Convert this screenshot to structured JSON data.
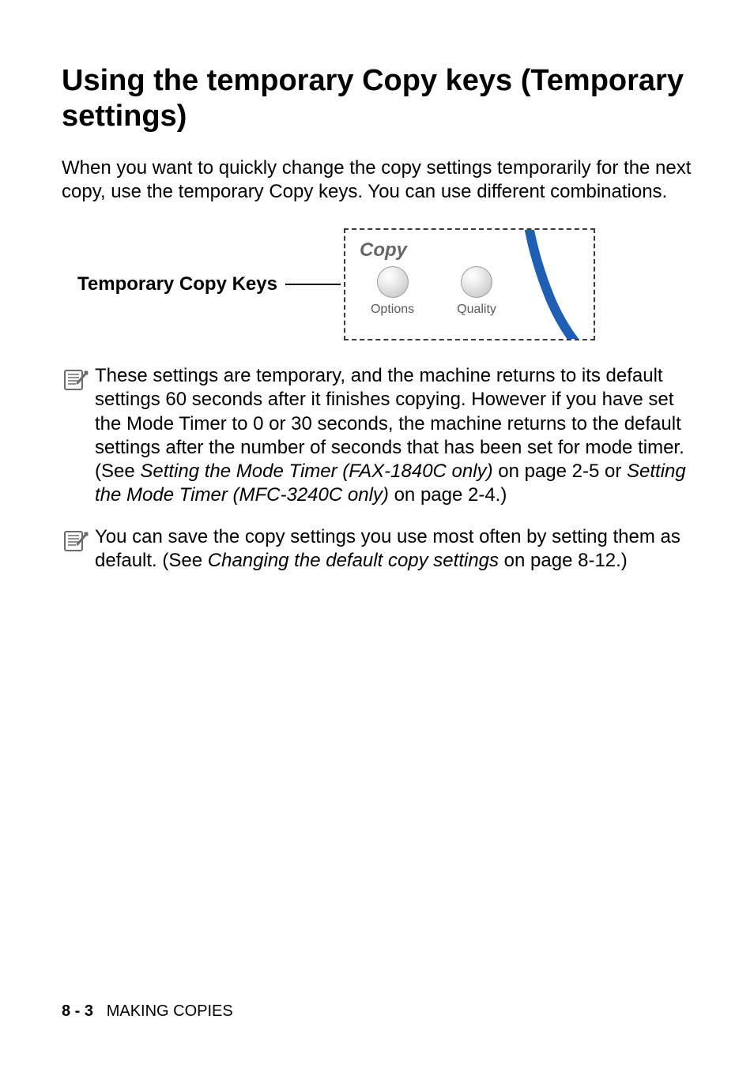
{
  "heading": "Using the temporary Copy keys (Temporary settings)",
  "intro": "When you want to quickly change the copy settings temporarily for the next copy, use the temporary Copy keys. You can use different combinations.",
  "tck_label": "Temporary Copy Keys",
  "panel": {
    "title": "Copy",
    "btn1": "Options",
    "btn2": "Quality"
  },
  "note1": {
    "part1": "These settings are temporary, and the machine returns to its default settings 60 seconds after it finishes copying. However if you have set the Mode Timer to 0 or 30 seconds, the machine returns to the default settings after the number of seconds that has been set for mode timer. (See ",
    "ital1": "Setting the Mode Timer (FAX-1840C only)",
    "mid1": " on page 2-5 or ",
    "ital2": "Setting the Mode Timer (MFC-3240C only)",
    "end1": " on page 2-4.)"
  },
  "note2": {
    "part1": "You can save the copy settings you use most often by setting them as default. (See ",
    "ital1": "Changing the default copy settings",
    "end1": " on page 8-12.)"
  },
  "footer": {
    "page": "8 - 3",
    "section": "MAKING COPIES"
  }
}
